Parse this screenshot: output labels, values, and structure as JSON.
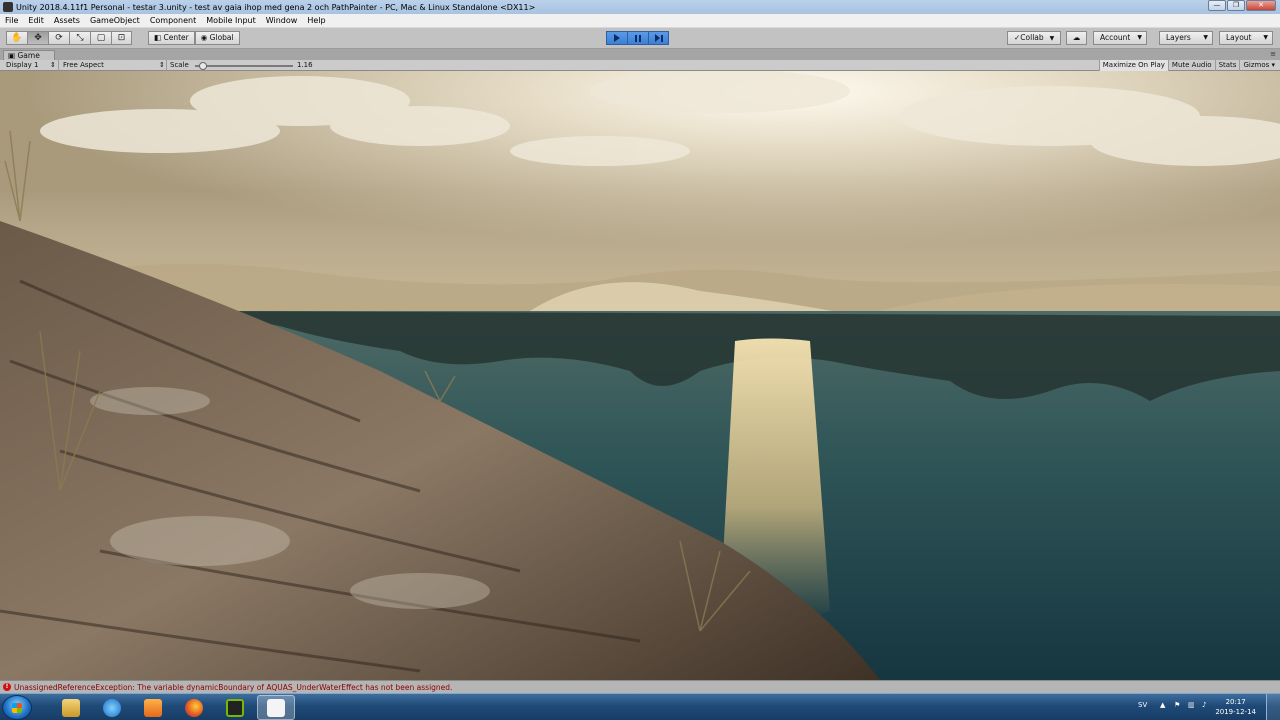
{
  "window": {
    "title": "Unity 2018.4.11f1 Personal - testar 3.unity - test av gaia ihop med gena 2 och PathPainter - PC, Mac & Linux Standalone <DX11>",
    "minimize": "—",
    "maximize": "❐",
    "close": "✕"
  },
  "menu": [
    "File",
    "Edit",
    "Assets",
    "GameObject",
    "Component",
    "Mobile Input",
    "Window",
    "Help"
  ],
  "toolbar": {
    "tools": [
      "hand-tool",
      "move-tool",
      "rotate-tool",
      "scale-tool",
      "rect-tool",
      "transform-tool"
    ],
    "pivot": "Center",
    "space": "Global",
    "collab": "Collab",
    "account": "Account",
    "layers": "Layers",
    "layout": "Layout",
    "accent": "#3c7fd4"
  },
  "game_tab": {
    "label": "Game",
    "menu": "≡"
  },
  "game_bar": {
    "display": "Display 1",
    "aspect": "Free Aspect",
    "scale_label": "Scale",
    "scale_value": "1.16",
    "maximize_on_play": "Maximize On Play",
    "mute_audio": "Mute Audio",
    "stats": "Stats",
    "gizmos": "Gizmos"
  },
  "status": {
    "message": "UnassignedReferenceException: The variable dynamicBoundary of AQUAS_UnderWaterEffect has not been assigned.",
    "error_color": "#d01010"
  },
  "taskbar": {
    "apps": [
      "explorer-icon",
      "ie-icon",
      "media-player-icon",
      "firefox-icon",
      "nvidia-icon",
      "unity-icon"
    ],
    "language": "SV",
    "time": "20:17",
    "date": "2019-12-14"
  }
}
